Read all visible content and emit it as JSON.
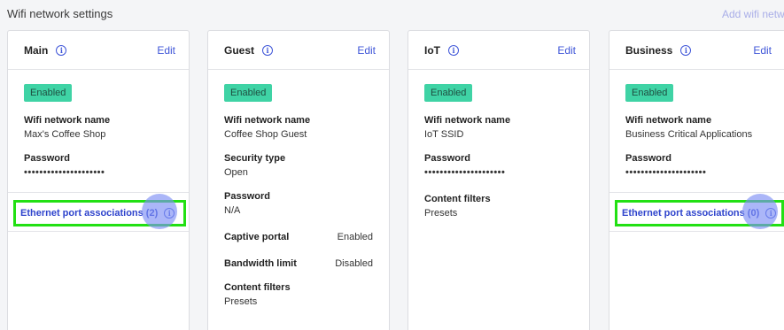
{
  "header": {
    "title": "Wifi network settings",
    "add_link": "Add wifi network"
  },
  "cards": {
    "main": {
      "title": "Main",
      "edit": "Edit",
      "status": "Enabled",
      "ssid_label": "Wifi network name",
      "ssid_value": "Max's Coffee Shop",
      "password_label": "Password",
      "password_value": "•••••••••••••••••••••",
      "assoc_label": "Ethernet port associations (2)"
    },
    "guest": {
      "title": "Guest",
      "edit": "Edit",
      "status": "Enabled",
      "ssid_label": "Wifi network name",
      "ssid_value": "Coffee Shop Guest",
      "security_label": "Security type",
      "security_value": "Open",
      "password_label": "Password",
      "password_value": "N/A",
      "captive_label": "Captive portal",
      "captive_value": "Enabled",
      "bandwidth_label": "Bandwidth limit",
      "bandwidth_value": "Disabled",
      "filters_label": "Content filters",
      "filters_value": "Presets"
    },
    "iot": {
      "title": "IoT",
      "edit": "Edit",
      "status": "Enabled",
      "ssid_label": "Wifi network name",
      "ssid_value": "IoT SSID",
      "password_label": "Password",
      "password_value": "•••••••••••••••••••••",
      "filters_label": "Content filters",
      "filters_value": "Presets"
    },
    "business": {
      "title": "Business",
      "edit": "Edit",
      "status": "Enabled",
      "ssid_label": "Wifi network name",
      "ssid_value": "Business Critical Applications",
      "password_label": "Password",
      "password_value": "•••••••••••••••••••••",
      "assoc_label": "Ethernet port associations (0)"
    }
  },
  "icons": {
    "info": "info-icon"
  },
  "colors": {
    "accent": "#3f56d8",
    "badge": "#3fd3a5",
    "highlight": "#22e013"
  }
}
